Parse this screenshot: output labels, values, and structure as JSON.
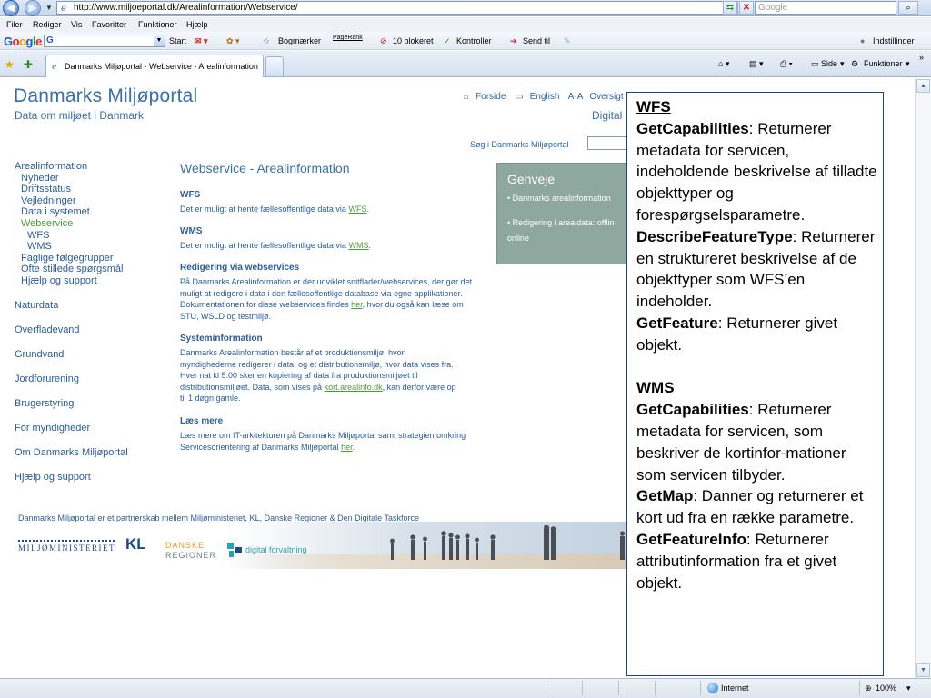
{
  "browser": {
    "url": "http://www.miljoeportal.dk/Arealinformation/Webservice/",
    "search_placeholder": "Google",
    "menu": [
      "Filer",
      "Rediger",
      "Vis",
      "Favoritter",
      "Funktioner",
      "Hjælp"
    ],
    "google_toolbar": {
      "logo": "Google",
      "start": "Start",
      "bookmarks": "Bogmærker",
      "pagerank": "PageRank",
      "blocked": "10 blokeret",
      "check": "Kontroller",
      "send": "Send til",
      "settings": "Indstillinger"
    },
    "tab_title": "Danmarks Miljøportal - Webservice - Arealinformation",
    "cmd": {
      "page": "Side",
      "tools": "Funktioner"
    },
    "status": {
      "zone": "Internet",
      "zoom": "100%"
    }
  },
  "site": {
    "brand_title": "Danmarks Miljøportal",
    "brand_subtitle": "Data om miljøet i Danmark",
    "top_links": [
      "Forside",
      "English",
      "Oversigt"
    ],
    "digital": "Digital",
    "search_label": "Søg i Danmarks Miljøportal",
    "left_nav": [
      {
        "label": "Arealinformation",
        "level": 0,
        "selected": false
      },
      {
        "label": "Nyheder",
        "level": 1,
        "selected": false
      },
      {
        "label": "Driftsstatus",
        "level": 1,
        "selected": false
      },
      {
        "label": "Vejledninger",
        "level": 1,
        "selected": false
      },
      {
        "label": "Data i systemet",
        "level": 1,
        "selected": false
      },
      {
        "label": "Webservice",
        "level": 1,
        "selected": true
      },
      {
        "label": "WFS",
        "level": 2,
        "selected": false
      },
      {
        "label": "WMS",
        "level": 2,
        "selected": false
      },
      {
        "label": "Faglige følgegrupper",
        "level": 1,
        "selected": false
      },
      {
        "label": "Ofte stillede spørgsmål",
        "level": 1,
        "selected": false
      },
      {
        "label": "Hjælp og support",
        "level": 1,
        "selected": false
      }
    ],
    "left_nav_sections": [
      "Naturdata",
      "Overfladevand",
      "Grundvand",
      "Jordforurening",
      "Brugerstyring",
      "For myndigheder",
      "Om Danmarks Miljøportal",
      "Hjælp og support"
    ],
    "main_title": "Webservice - Arealinformation",
    "sections": {
      "wfs": {
        "heading": "WFS",
        "text": "Det er muligt at hente fællesoffentlige data via",
        "link": "WFS",
        "tail": "."
      },
      "wms": {
        "heading": "WMS",
        "text": "Det er muligt at hente fællesoffentlige data via",
        "link": "WMS",
        "tail": "."
      },
      "editing": {
        "heading": "Redigering via webservices",
        "text": "På Danmarks Arealinformation er der udviklet snitflader/webservices, der gør det muligt at redigere i data i den fællesoffentlige database via egne applikationer. Dokumentationen for disse webservices findes",
        "link": "her",
        "tail": ", hvor du også kan læse om STU, WSLD og testmiljø."
      },
      "system": {
        "heading": "Systeminformation",
        "text": "Danmarks Arealinformation består af et produktionsmiljø, hvor myndighederne redigerer i data, og et distributionsmiljø, hvor data vises fra. Hver nat kl 5:00 sker en kopiering af data fra produktionsmiljøet til distributionsmiljøet. Data, som vises på",
        "link": "kort.arealinfo.dk",
        "tail": ", kan derfor være op til 1 døgn gamle."
      },
      "more": {
        "heading": "Læs mere",
        "text": "Læs mere om IT-arkitekturen på Danmarks Miljøportal samt strategien omkring Servicesorientering af Danmarks Miljøportal",
        "link": "her",
        "tail": "."
      }
    },
    "genveje": {
      "title": "Genveje",
      "item1": "• Danmarks arealinformation",
      "item2_line1": "• Redigering i arealdata: offlin",
      "item2_line2": "online"
    },
    "footer_text": "Danmarks Miljøportal er et partnerskab mellem Miljøministeriet, KL, Danske Regioner & Den Digitale Taskforce",
    "logos": {
      "mil": "MILJØMINISTERIET",
      "kl": "KL",
      "dr1": "DANSKE",
      "dr2": "REGIONER",
      "df": "digital forvaltning"
    }
  },
  "overlay": {
    "wfs_heading": "WFS",
    "wfs_gc_term": "GetCapabilities",
    "wfs_gc_desc": ": Returnerer metadata for servicen, indeholdende beskrivelse af tilladte objekttyper og forespørgselsparametre.",
    "wfs_dft_term": "DescribeFeatureType",
    "wfs_dft_desc": ": Returnerer en struktureret beskrivelse af de objekttyper som WFS’en indeholder.",
    "wfs_gf_term": "GetFeature",
    "wfs_gf_desc": ": Returnerer givet objekt.",
    "wms_heading": "WMS",
    "wms_gc_term": "GetCapabilities",
    "wms_gc_desc": ": Returnerer metadata for servicen, som beskriver de kortinfor-mationer som servicen tilbyder.",
    "wms_gm_term": "GetMap",
    "wms_gm_desc": ": Danner og returnerer et kort ud fra en række parametre.",
    "wms_gfi_term": "GetFeatureInfo",
    "wms_gfi_desc": ": Returnerer attributinformation fra et givet objekt."
  }
}
